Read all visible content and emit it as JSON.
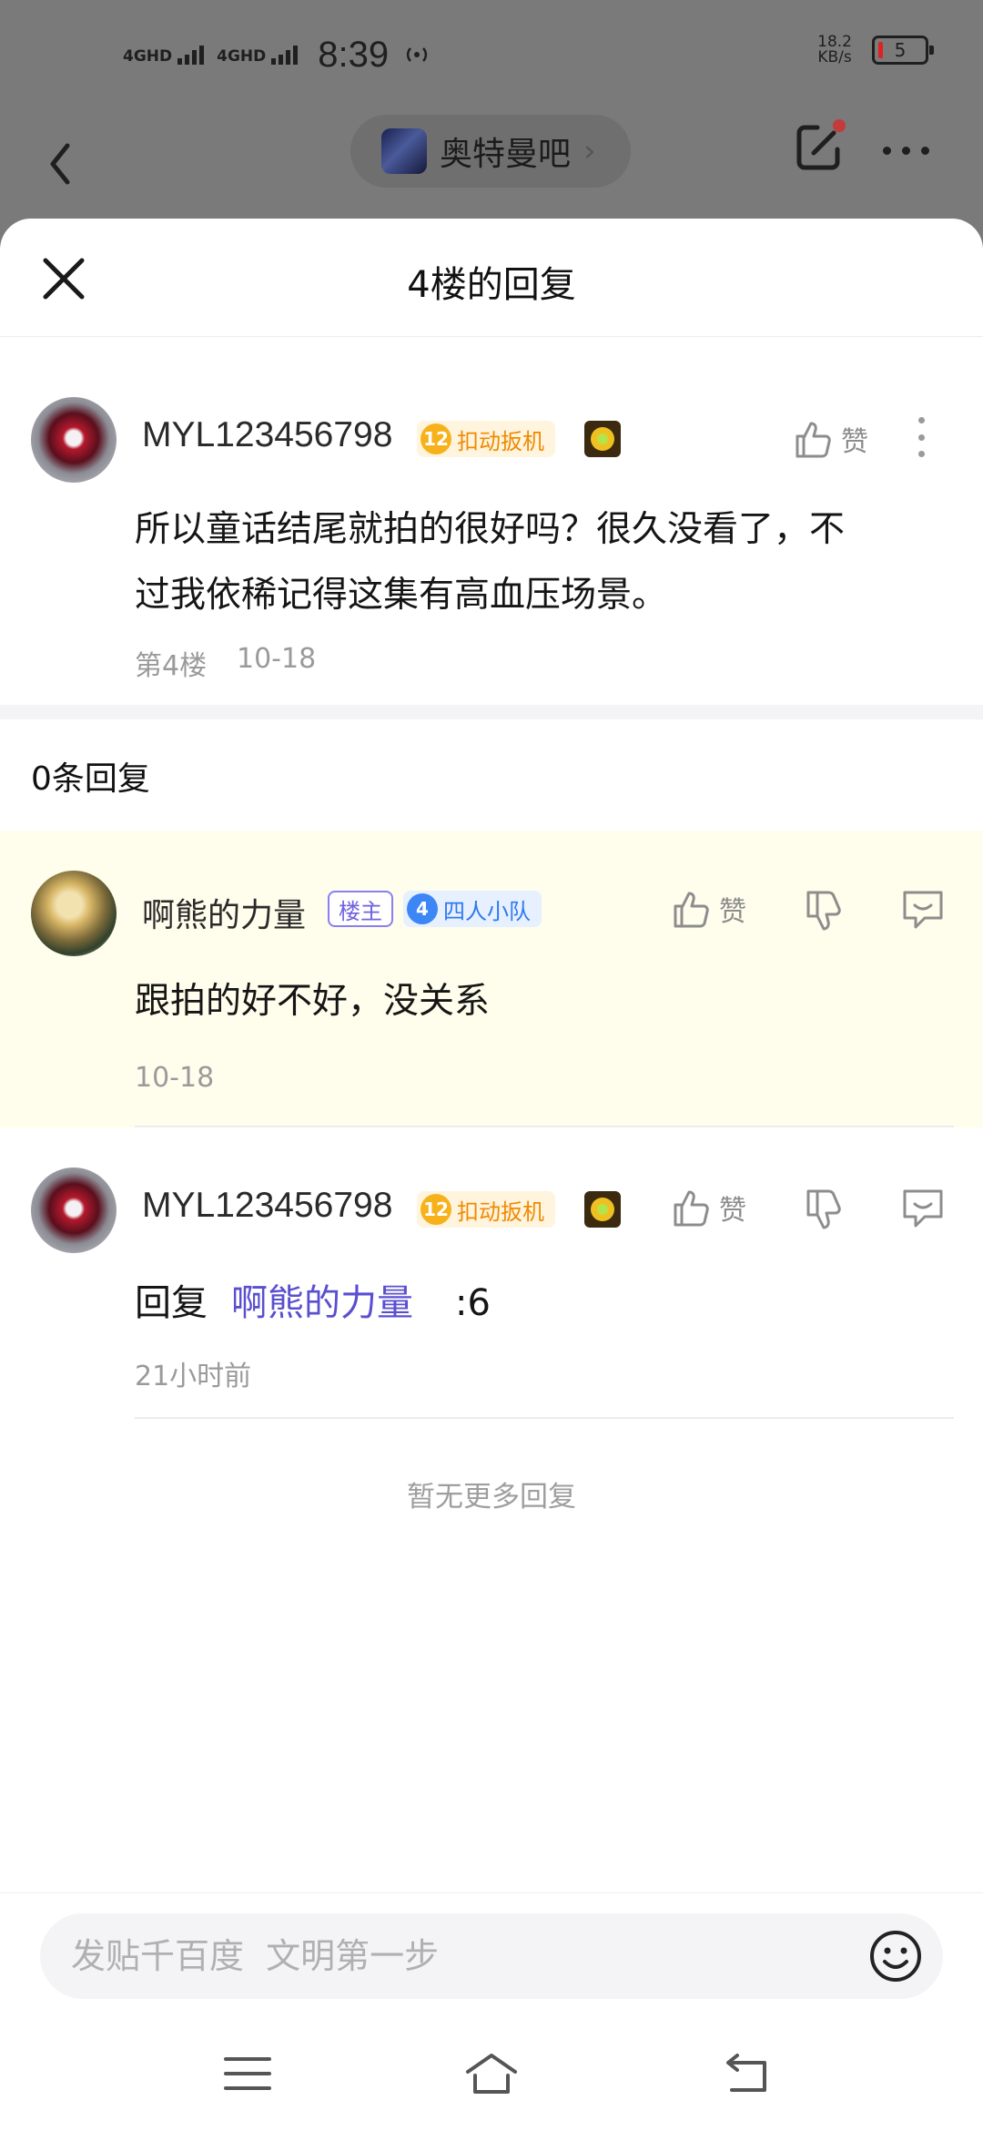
{
  "status_bar": {
    "sim1_label": "4GHD",
    "sim2_label": "4GHD",
    "time": "8:39",
    "net_speed_value": "18.2",
    "net_speed_unit": "KB/s",
    "battery": "5"
  },
  "top_nav": {
    "forum_name": "奥特曼吧",
    "forum_chevron": "›"
  },
  "sheet": {
    "title": "4楼的回复"
  },
  "main_post": {
    "username": "MYL123456798",
    "level": "12",
    "level_title": "扣动扳机",
    "like_label": "赞",
    "text_line1": "所以童话结尾就拍的很好吗？很久没看了，不",
    "text_line2": "过我依稀记得这集有高血压场景。",
    "floor": "第4楼",
    "date": "10-18"
  },
  "replies_header": {
    "count_text": "0条回复"
  },
  "replies": [
    {
      "username": "啊熊的力量",
      "owner_tag": "楼主",
      "level": "4",
      "level_title": "四人小队",
      "like_label": "赞",
      "text": "跟拍的好不好，没关系",
      "time": "10-18"
    },
    {
      "username": "MYL123456798",
      "level": "12",
      "level_title": "扣动扳机",
      "like_label": "赞",
      "reply_prefix": "回复",
      "mention": "啊熊的力量",
      "text_tail": ":6",
      "time": "21小时前"
    }
  ],
  "footer_note": "暂无更多回复",
  "composer": {
    "placeholder": "发贴千百度  文明第一步"
  },
  "icons": {
    "back": "back-arrow-icon",
    "edit": "edit-icon",
    "more": "more-icon",
    "close": "close-icon",
    "like": "thumbs-up-icon",
    "dislike": "thumbs-down-icon",
    "comment": "comment-icon",
    "emoji": "emoji-icon",
    "menu": "menu-icon",
    "home": "home-icon",
    "return": "return-icon"
  },
  "colors": {
    "accent_mention": "#5a4fcf",
    "highlight_bg": "#fffdec",
    "level_orange": "#f08a00",
    "level_blue": "#2f79f0"
  }
}
